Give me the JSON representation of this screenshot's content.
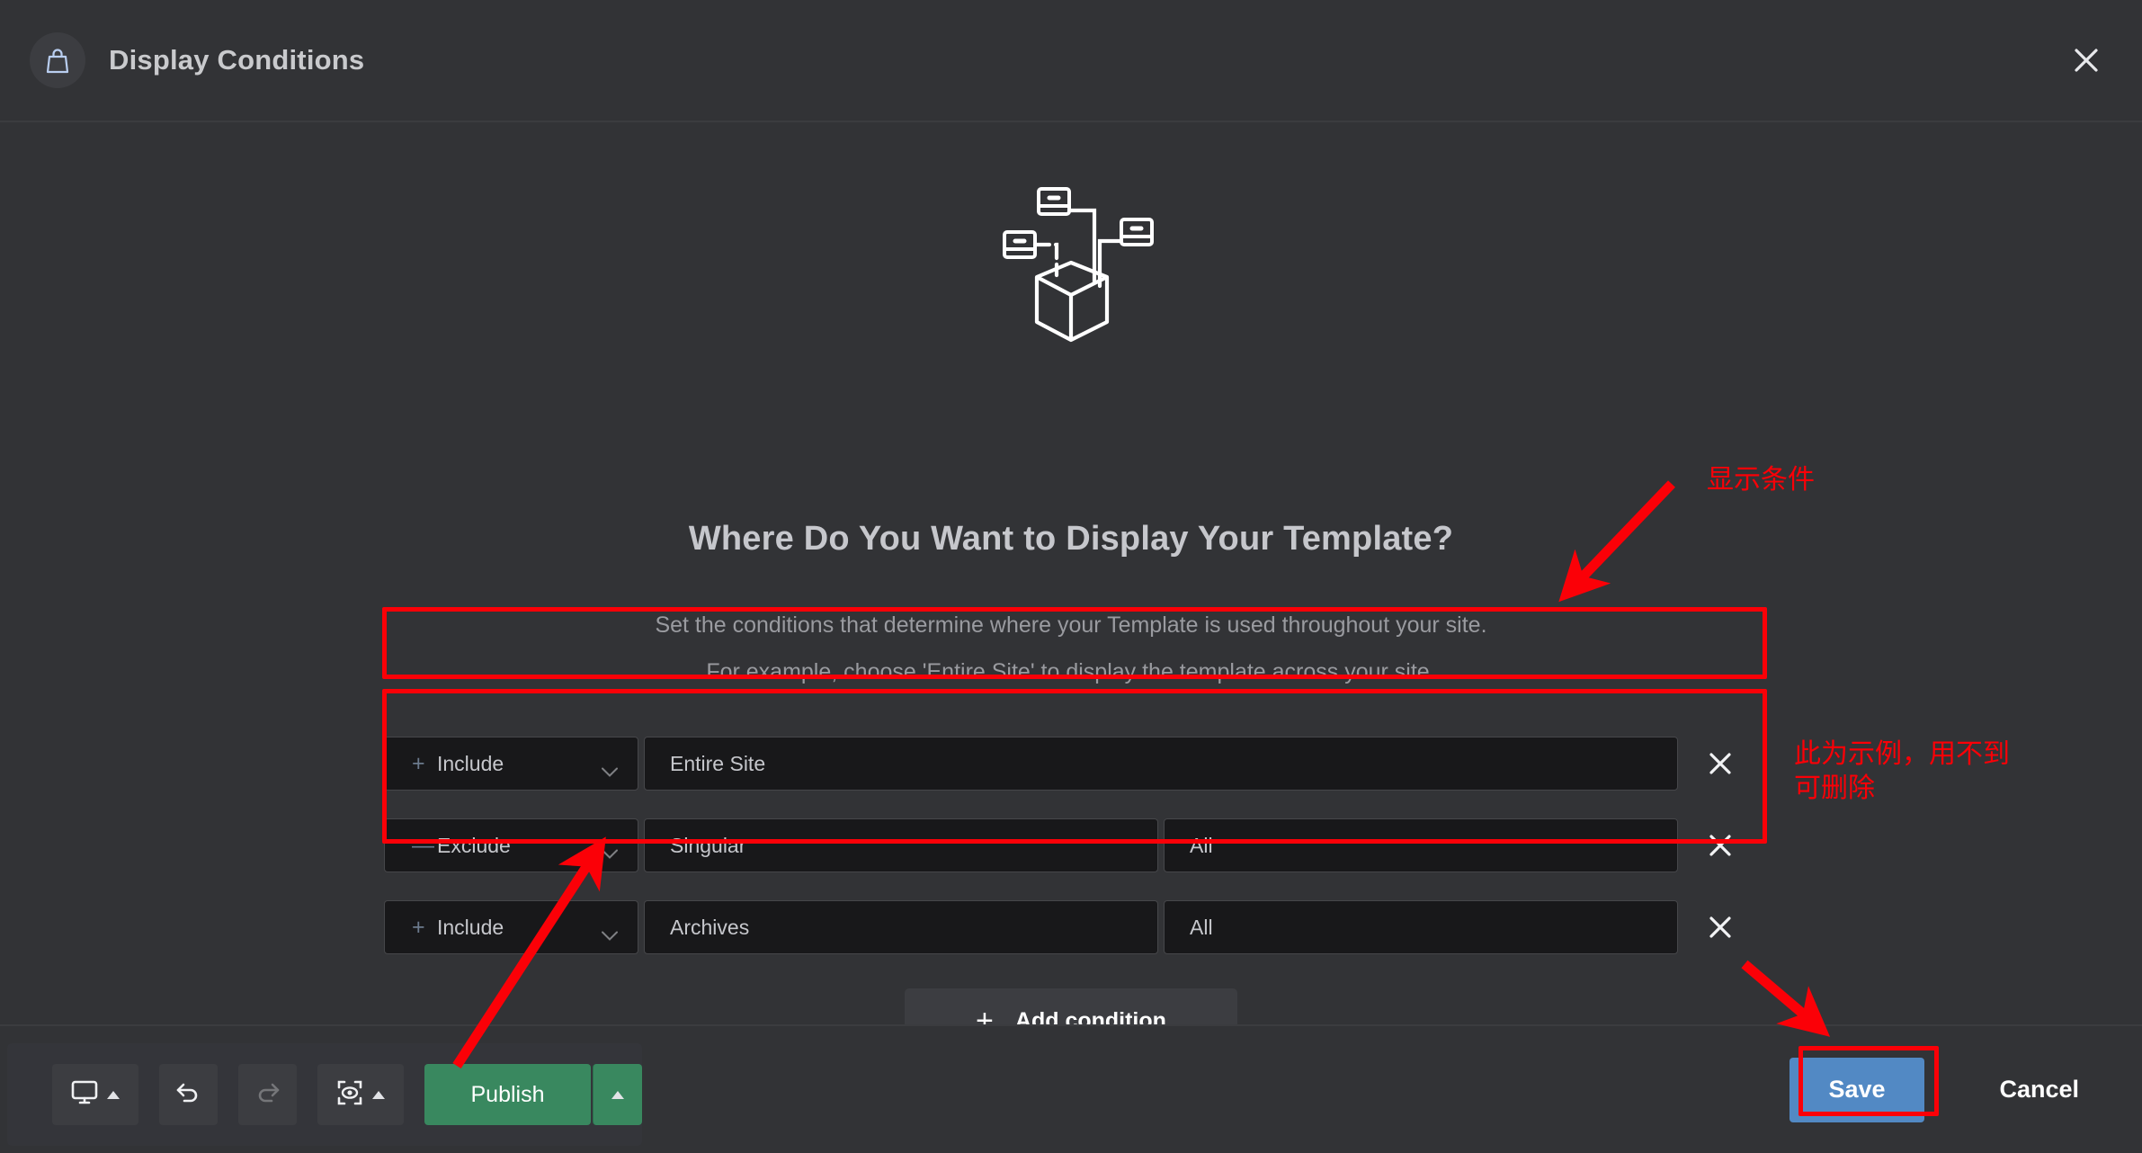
{
  "header": {
    "title": "Display Conditions",
    "icon": "bag-icon",
    "close_icon": "close-icon"
  },
  "main": {
    "illustration_icon": "template-conditions-illustration",
    "title": "Where Do You Want to Display Your Template?",
    "subtitle_line1": "Set the conditions that determine where your Template is used throughout your site.",
    "subtitle_line2": "For example, choose 'Entire Site' to display the template across your site.",
    "add_condition": {
      "plus": "+",
      "label": "Add condition"
    },
    "conditions": [
      {
        "type_sign": "+",
        "type_label": "Include",
        "name": "Entire Site",
        "value": null,
        "remove_icon": "close-icon"
      },
      {
        "type_sign": "—",
        "type_label": "Exclude",
        "name": "Singular",
        "value": "All",
        "remove_icon": "close-icon"
      },
      {
        "type_sign": "+",
        "type_label": "Include",
        "name": "Archives",
        "value": "All",
        "remove_icon": "close-icon"
      }
    ]
  },
  "footer": {
    "save_label": "Save",
    "cancel_label": "Cancel"
  },
  "toolbar": {
    "responsive_icon": "desktop-icon",
    "undo_icon": "undo-icon",
    "redo_icon": "redo-icon",
    "preview_icon": "preview-eye-icon",
    "publish_label": "Publish",
    "publish_caret_icon": "caret-up-icon"
  },
  "annotations": {
    "accent_color": "#fb0007",
    "note_display_conditions": "显示条件",
    "note_example_removable": "此为示例，用不到\n可删除"
  },
  "colors": {
    "background": "#323336",
    "field_background": "#18181a",
    "publish_green": "#39885f",
    "save_blue": "#5289c4",
    "annotation_red": "#fb0007",
    "sign_blue": "#6b7a8d"
  }
}
